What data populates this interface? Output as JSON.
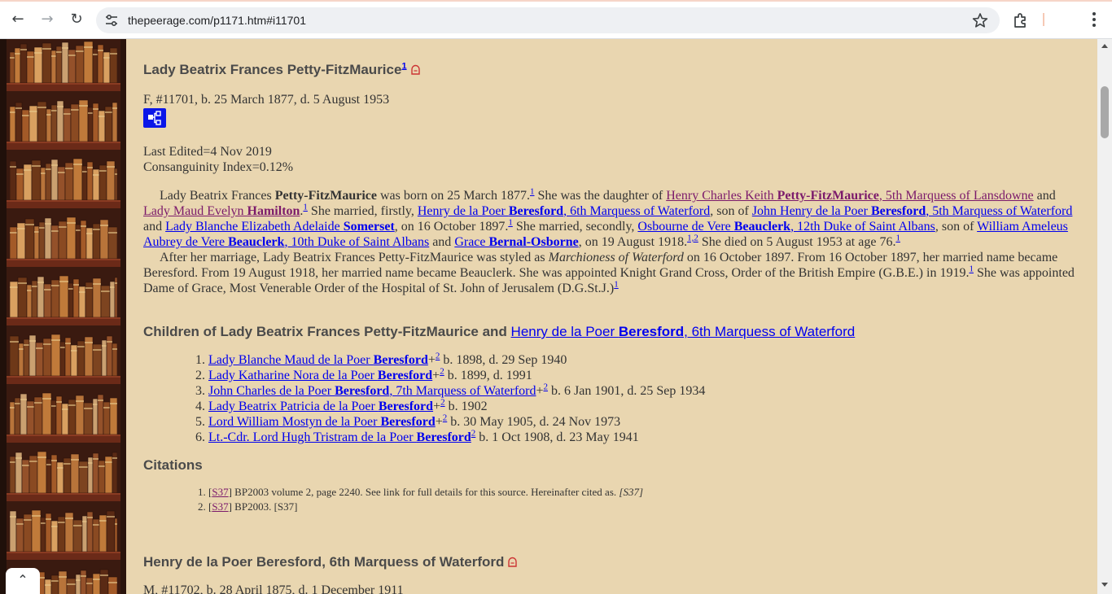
{
  "browser": {
    "url": "thepeerage.com/p1171.htm#i11701",
    "back_label": "←",
    "forward_label": "→",
    "reload_label": "↻"
  },
  "person": {
    "name": "Lady Beatrix Frances Petty-FitzMaurice",
    "name_sup": "1",
    "summary": "F, #11701, b. 25 March 1877, d. 5 August 1953",
    "last_edited": "Last Edited=4 Nov 2019",
    "consanguinity": "Consanguinity Index=0.12%"
  },
  "bio": {
    "s1a": "Lady Beatrix Frances ",
    "s1b": "Petty-FitzMaurice",
    "s1c": " was born on 25 March 1877.",
    "s1sup": "1",
    "s2a": " She was the daughter of ",
    "father_a": "Henry Charles Keith ",
    "father_b": "Petty-FitzMaurice",
    "father_c": ", 5th Marquess of Lansdowne",
    "and1": " and ",
    "mother_a": "Lady Maud Evelyn ",
    "mother_b": "Hamilton",
    "s2end": ".",
    "s2sup": "1",
    "s3a": " She married, firstly, ",
    "hus1_a": "Henry de la Poer ",
    "hus1_b": "Beresford",
    "hus1_c": ", 6th Marquess of Waterford",
    "sonof": ", son of ",
    "hus1f_a": "John Henry de la Poer ",
    "hus1f_b": "Beresford",
    "hus1f_c": ", 5th Marquess of Waterford",
    "and2": " and ",
    "hus1m_a": "Lady Blanche Elizabeth Adelaide ",
    "hus1m_b": "Somerset",
    "s3end": ", on 16 October 1897.",
    "s3sup": "1",
    "s4a": " She married, secondly, ",
    "hus2_a": "Osbourne de Vere ",
    "hus2_b": "Beauclerk",
    "hus2_c": ", 12th Duke of Saint Albans",
    "sonof2": ", son of ",
    "hus2f_a": "William Ameleus Aubrey de Vere ",
    "hus2f_b": "Beauclerk",
    "hus2f_c": ", 10th Duke of Saint Albans",
    "and3": " and ",
    "hus2m_a": "Grace ",
    "hus2m_b": "Bernal-Osborne",
    "s4end": ", on 19 August 1918.",
    "s4sup": "1,2",
    "s5": " She died on 5 August 1953 at age 76.",
    "s5sup": "1",
    "p2a": "After her marriage, Lady Beatrix Frances Petty-FitzMaurice was styled as ",
    "p2title": "Marchioness of Waterford",
    "p2b": " on 16 October 1897. From 16 October 1897, her married name became Beresford. From 19 August 1918, her married name became Beauclerk. She was appointed Knight Grand Cross, Order of the British Empire (G.B.E.) in 1919.",
    "p2sup1": "1",
    "p2c": " She was appointed Dame of Grace, Most Venerable Order of the Hospital of St. John of Jerusalem (D.G.St.J.)",
    "p2sup2": "1"
  },
  "children_heading": {
    "prefix": "Children of Lady Beatrix Frances Petty-FitzMaurice and ",
    "link_a": "Henry de la Poer ",
    "link_b": "Beresford",
    "link_c": ", 6th Marquess of Waterford"
  },
  "children": [
    {
      "num": "1.",
      "a": "Lady Blanche Maud de la Poer ",
      "b": "Beresford",
      "c": "",
      "plus": "+",
      "sup": "2",
      "dates": " b. 1898, d. 29 Sep 1940"
    },
    {
      "num": "2.",
      "a": "Lady Katharine Nora de la Poer ",
      "b": "Beresford",
      "c": "",
      "plus": "+",
      "sup": "2",
      "dates": " b. 1899, d. 1991"
    },
    {
      "num": "3.",
      "a": "John Charles de la Poer ",
      "b": "Beresford",
      "c": ", 7th Marquess of Waterford",
      "plus": "+",
      "sup": "2",
      "dates": " b. 6 Jan 1901, d. 25 Sep 1934"
    },
    {
      "num": "4.",
      "a": "Lady Beatrix Patricia de la Poer ",
      "b": "Beresford",
      "c": "",
      "plus": "+",
      "sup": "2",
      "dates": " b. 1902"
    },
    {
      "num": "5.",
      "a": "Lord William Mostyn de la Poer ",
      "b": "Beresford",
      "c": "",
      "plus": "+",
      "sup": "2",
      "dates": " b. 30 May 1905, d. 24 Nov 1973"
    },
    {
      "num": "6.",
      "a": "Lt.-Cdr. Lord Hugh Tristram de la Poer ",
      "b": "Beresford",
      "c": "",
      "plus": "",
      "sup": "2",
      "dates": " b. 1 Oct 1908, d. 23 May 1941"
    }
  ],
  "citations_heading": "Citations",
  "citations": [
    {
      "num": "1.",
      "open": "[",
      "code": "S37",
      "close": "]",
      "text": " BP2003 volume 2, page 2240. See link for full details for this source. Hereinafter cited as. ",
      "ital": "[S37]"
    },
    {
      "num": "2.",
      "open": "[",
      "code": "S37",
      "close": "]",
      "text": " BP2003. [S37]",
      "ital": ""
    }
  ],
  "next_person": {
    "name": "Henry de la Poer Beresford, 6th Marquess of Waterford",
    "summary": "M, #11702, b. 28 April 1875, d. 1 December 1911"
  },
  "colors": {
    "link": "#0000ee",
    "visited": "#7b1a6b",
    "tree_button": "#0a16e8",
    "page_bg": "#e9d6b0"
  }
}
